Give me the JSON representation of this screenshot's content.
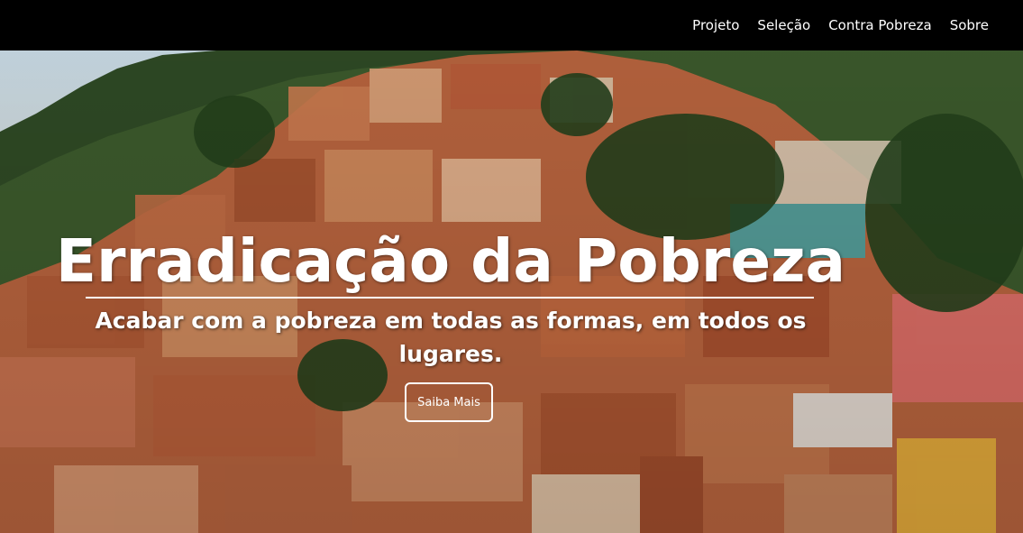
{
  "nav": {
    "items": [
      {
        "label": "Projeto"
      },
      {
        "label": "Seleção"
      },
      {
        "label": "Contra Pobreza"
      },
      {
        "label": "Sobre"
      }
    ]
  },
  "hero": {
    "title": "Erradicação da Pobreza",
    "subtitle": "Acabar com a pobreza em todas as formas, em todos os lugares.",
    "button_label": "Saiba Mais"
  },
  "colors": {
    "navbar_bg": "#000000",
    "text": "#ffffff"
  }
}
